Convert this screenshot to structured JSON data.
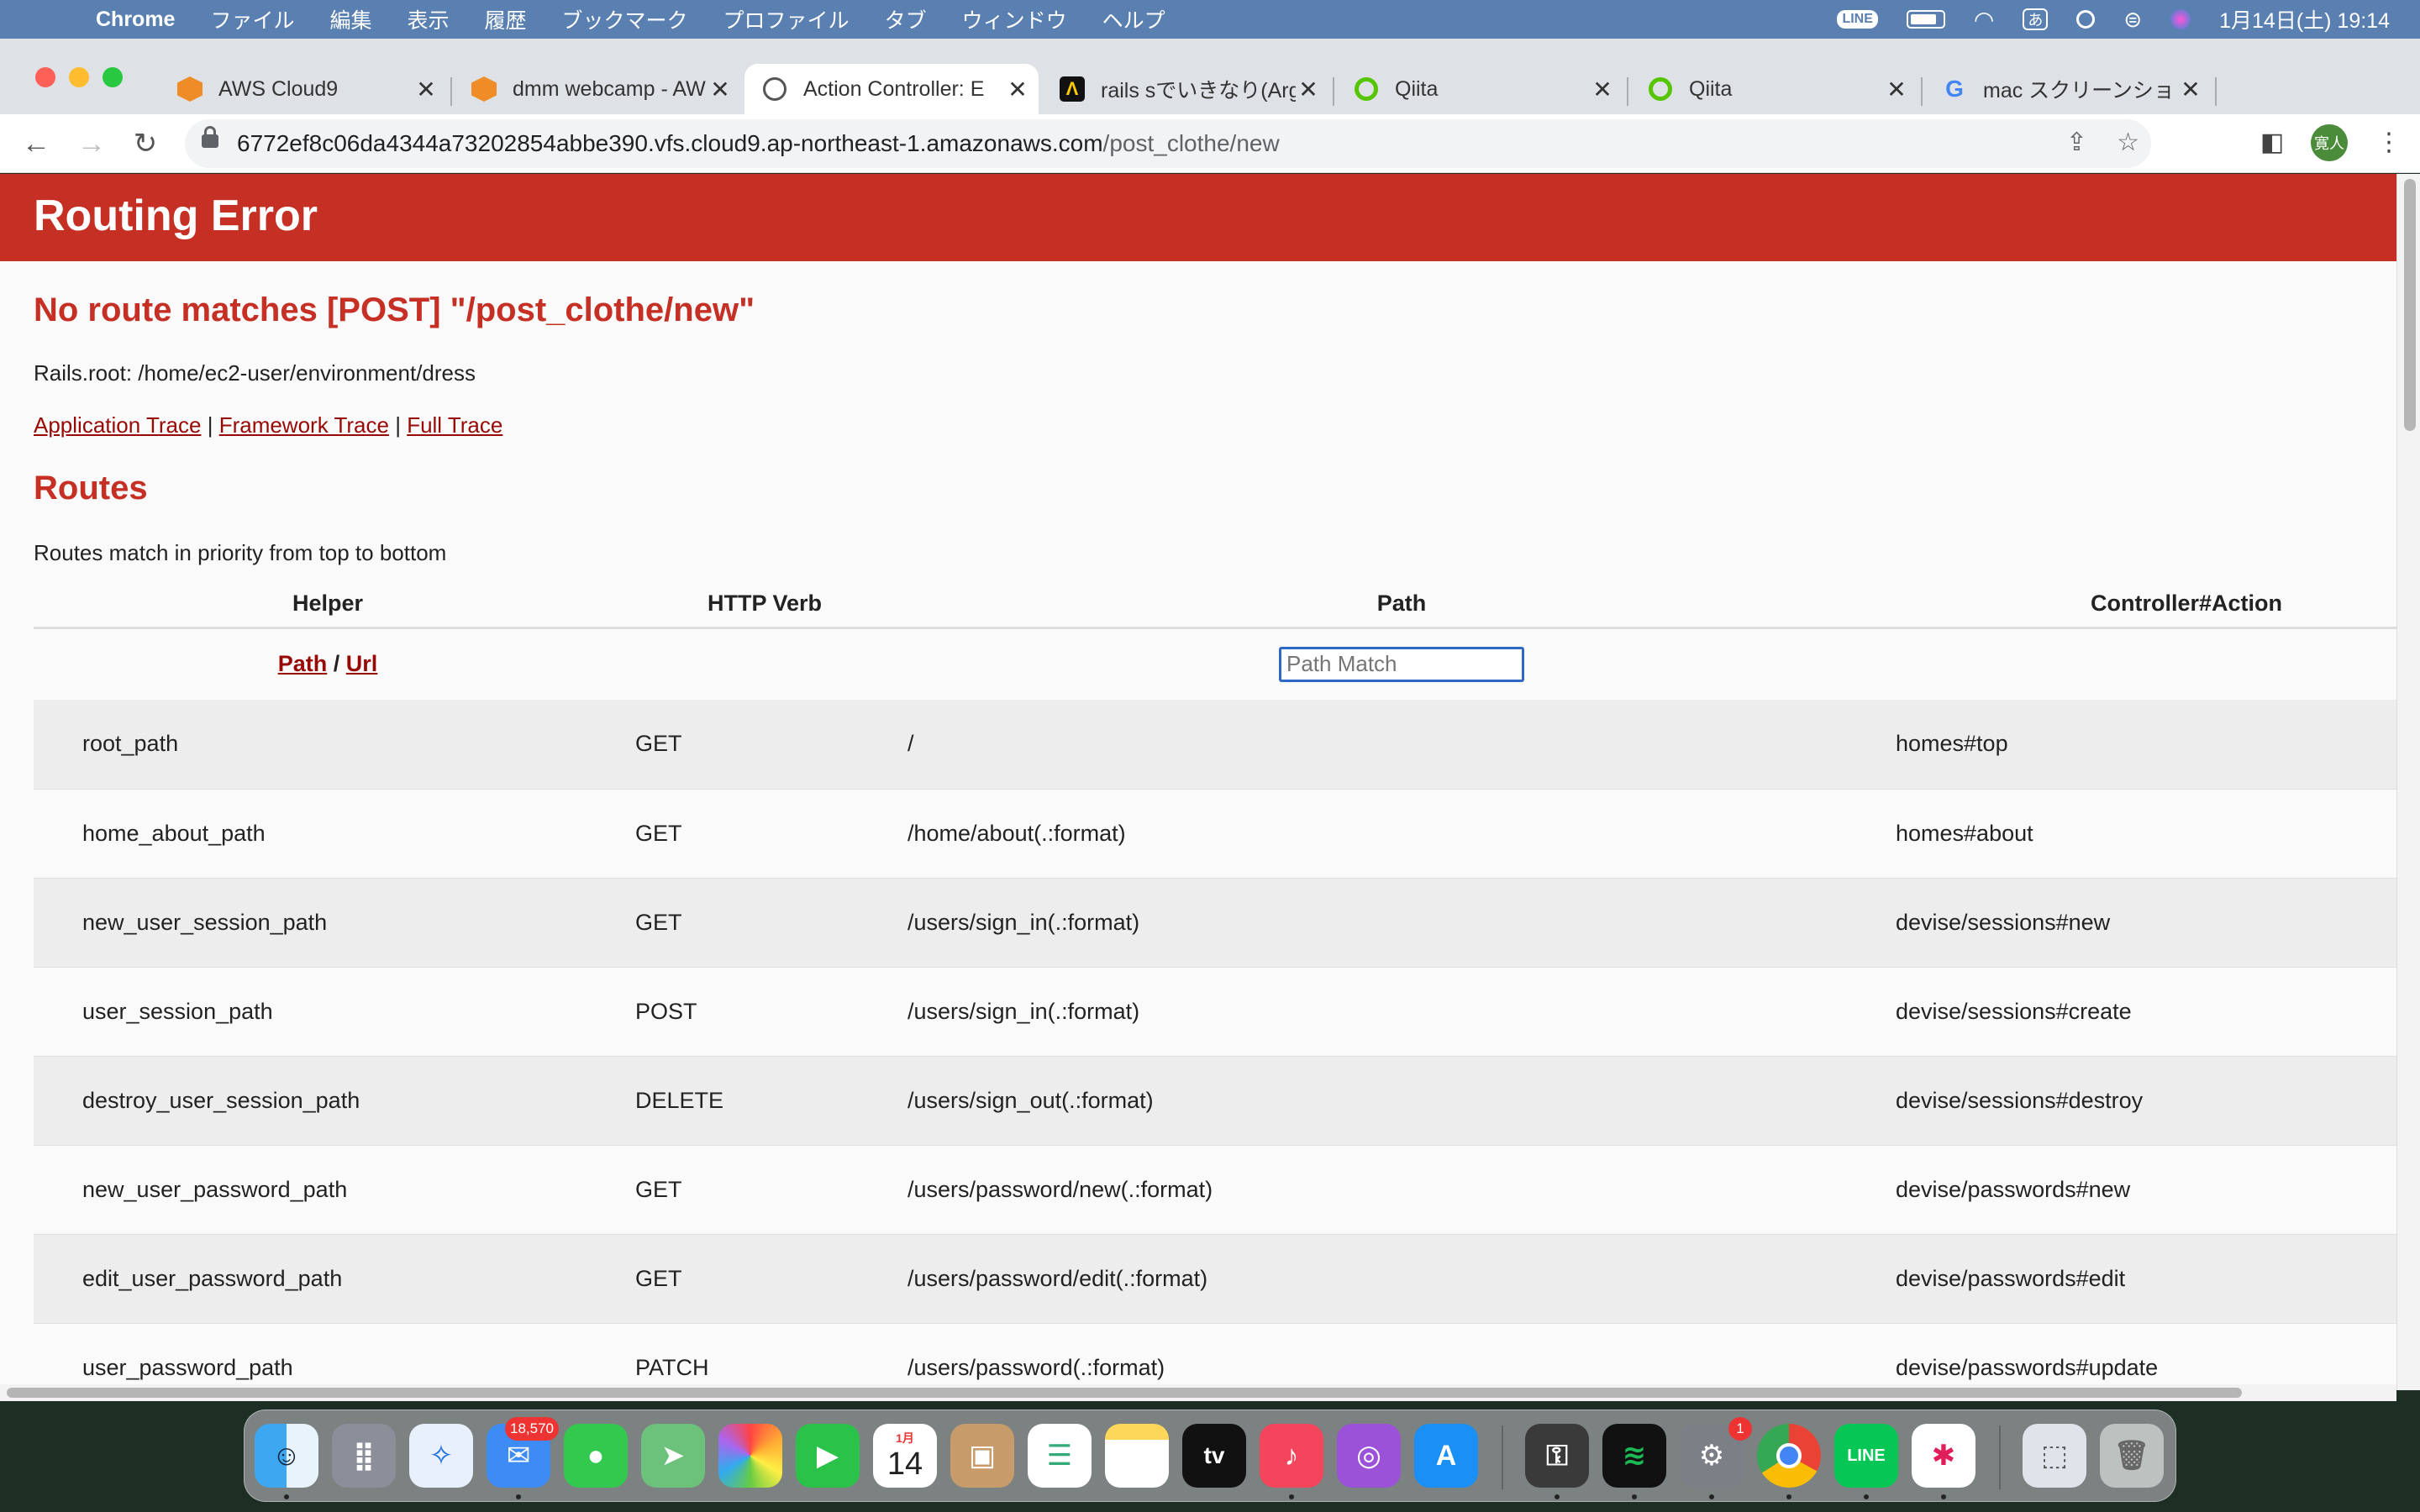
{
  "menubar": {
    "app": "Chrome",
    "items": [
      "ファイル",
      "編集",
      "表示",
      "履歴",
      "ブックマーク",
      "プロファイル",
      "タブ",
      "ウィンドウ",
      "ヘルプ"
    ],
    "input_method": "あ",
    "clock": "1月14日(土) 19:14",
    "status_icons": [
      "line-icon",
      "battery-icon",
      "wifi-icon",
      "input-method-icon",
      "search-icon",
      "control-center-icon",
      "siri-icon"
    ]
  },
  "tabs": [
    {
      "title": "AWS Cloud9",
      "icon": "cloud9-icon",
      "active": false
    },
    {
      "title": "dmm webcamp - AW",
      "icon": "cloud9-icon",
      "active": false
    },
    {
      "title": "Action Controller: E",
      "icon": "globe-icon",
      "active": true
    },
    {
      "title": "rails sでいきなり(Arg",
      "icon": "arc-icon",
      "active": false
    },
    {
      "title": "Qiita",
      "icon": "qiita-icon",
      "active": false
    },
    {
      "title": "Qiita",
      "icon": "qiita-icon",
      "active": false
    },
    {
      "title": "mac スクリーンショッ",
      "icon": "google-icon",
      "active": false
    }
  ],
  "address": {
    "host": "6772ef8c06da4344a73202854abbe390.vfs.cloud9.ap-northeast-1.amazonaws.com",
    "path": "/post_clothe/new"
  },
  "profile": {
    "initials": "寛人"
  },
  "page": {
    "title": "Routing Error",
    "error": "No route matches [POST] \"/post_clothe/new\"",
    "rails_root": "Rails.root: /home/ec2-user/environment/dress",
    "traces": [
      "Application Trace",
      "Framework Trace",
      "Full Trace"
    ],
    "trace_sep": "|",
    "routes_heading": "Routes",
    "routes_note": "Routes match in priority from top to bottom",
    "columns": [
      "Helper",
      "HTTP Verb",
      "Path",
      "Controller#Action"
    ],
    "filter": {
      "path_link": "Path",
      "slash": "/",
      "url_link": "Url",
      "placeholder": "Path Match"
    },
    "routes": [
      {
        "helper": "root_path",
        "verb": "GET",
        "path": "/",
        "action": "homes#top"
      },
      {
        "helper": "home_about_path",
        "verb": "GET",
        "path": "/home/about(.:format)",
        "action": "homes#about"
      },
      {
        "helper": "new_user_session_path",
        "verb": "GET",
        "path": "/users/sign_in(.:format)",
        "action": "devise/sessions#new"
      },
      {
        "helper": "user_session_path",
        "verb": "POST",
        "path": "/users/sign_in(.:format)",
        "action": "devise/sessions#create"
      },
      {
        "helper": "destroy_user_session_path",
        "verb": "DELETE",
        "path": "/users/sign_out(.:format)",
        "action": "devise/sessions#destroy"
      },
      {
        "helper": "new_user_password_path",
        "verb": "GET",
        "path": "/users/password/new(.:format)",
        "action": "devise/passwords#new"
      },
      {
        "helper": "edit_user_password_path",
        "verb": "GET",
        "path": "/users/password/edit(.:format)",
        "action": "devise/passwords#edit"
      },
      {
        "helper": "user_password_path",
        "verb": "PATCH",
        "path": "/users/password(.:format)",
        "action": "devise/passwords#update"
      }
    ]
  },
  "dock": {
    "apps": [
      "finder",
      "launchpad",
      "safari",
      "mail",
      "messages",
      "maps",
      "photos",
      "facetime",
      "calendar",
      "contacts",
      "reminders",
      "notes",
      "tv",
      "music",
      "podcasts",
      "app-store",
      "keychain",
      "spotify",
      "system-preferences",
      "chrome",
      "line",
      "slack",
      "screenshot",
      "trash"
    ],
    "mail_badge": "18,570",
    "settings_badge": "1",
    "calendar_month": "1月",
    "calendar_day": "14",
    "tv_label": "tv"
  },
  "colors": {
    "error_red": "#c52f24",
    "link_red": "#980905",
    "focus_blue": "#2e67c6"
  }
}
